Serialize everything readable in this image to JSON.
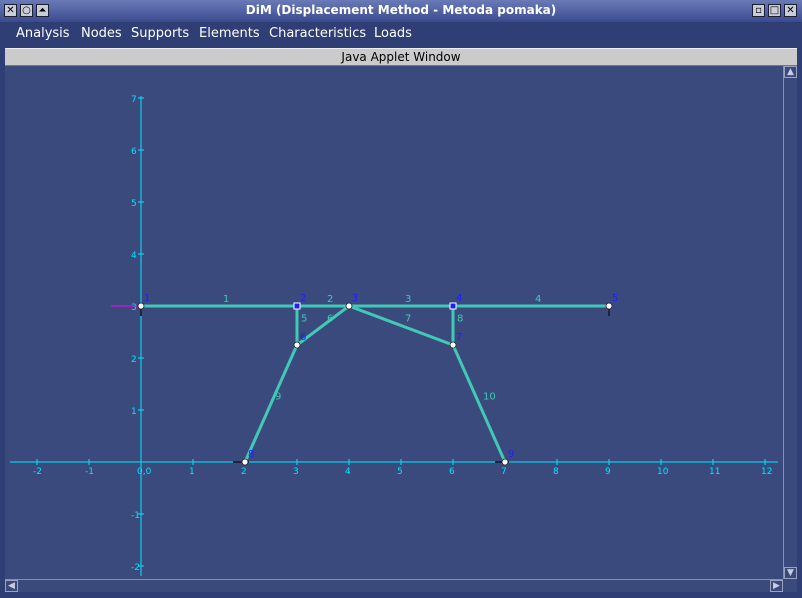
{
  "window": {
    "title": "DiM (Displacement Method - Metoda pomaka)",
    "left_buttons": [
      "close-icon",
      "circle-icon",
      "up-icon"
    ],
    "right_buttons": [
      "minimize-icon",
      "maximize-icon",
      "close-icon"
    ]
  },
  "menu": {
    "items": [
      "Analysis",
      "Nodes",
      "Supports",
      "Elements",
      "Characteristics",
      "Loads"
    ]
  },
  "applet_bar": {
    "label": "Java Applet Window"
  },
  "colors": {
    "background": "#3b4a7c",
    "axis": "#00e5ff",
    "element": "#40c9b5",
    "node_fill": "#ffffff",
    "node_label": "#1e1eff",
    "element_label": "#40c9b5",
    "load_arrow": "#ff00ff"
  },
  "diagram": {
    "x_ticks": [
      "-2",
      "-1",
      "0,0",
      "1",
      "2",
      "3",
      "4",
      "5",
      "6",
      "7",
      "8",
      "9",
      "10",
      "11",
      "12"
    ],
    "y_ticks": [
      "-2",
      "-1",
      "1",
      "2",
      "3",
      "4",
      "5",
      "6",
      "7"
    ],
    "nodes": [
      {
        "id": "1",
        "x": 0,
        "y": 3
      },
      {
        "id": "2",
        "x": 3,
        "y": 3
      },
      {
        "id": "3",
        "x": 4,
        "y": 3
      },
      {
        "id": "4",
        "x": 6,
        "y": 3
      },
      {
        "id": "5",
        "x": 9,
        "y": 3
      },
      {
        "id": "6",
        "x": 3,
        "y": 2.25
      },
      {
        "id": "7",
        "x": 6,
        "y": 2.25
      },
      {
        "id": "8",
        "x": 2,
        "y": 0
      },
      {
        "id": "9",
        "x": 7,
        "y": 0
      }
    ],
    "elements": [
      {
        "id": "1",
        "from": "1",
        "to": "2"
      },
      {
        "id": "2",
        "from": "2",
        "to": "3"
      },
      {
        "id": "3",
        "from": "3",
        "to": "4"
      },
      {
        "id": "4",
        "from": "4",
        "to": "5"
      },
      {
        "id": "5",
        "from": "2",
        "to": "6"
      },
      {
        "id": "6",
        "from": "6",
        "to": "3"
      },
      {
        "id": "7",
        "from": "3",
        "to": "7"
      },
      {
        "id": "8",
        "from": "4",
        "to": "7"
      },
      {
        "id": "9",
        "from": "8",
        "to": "6"
      },
      {
        "id": "10",
        "from": "7",
        "to": "9"
      }
    ]
  }
}
